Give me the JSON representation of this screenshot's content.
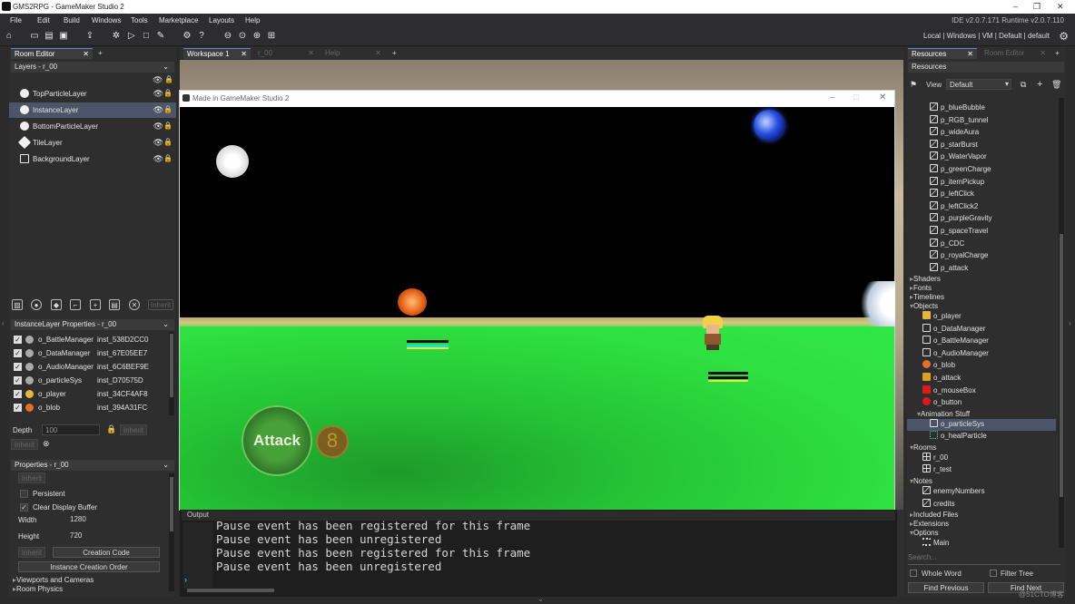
{
  "window": {
    "title": "GMS2RPG - GameMaker Studio 2",
    "ide_version": "IDE v2.0.7.171 Runtime v2.0.7.110"
  },
  "menu": [
    "File",
    "Edit",
    "Build",
    "Windows",
    "Tools",
    "Marketplace",
    "Layouts",
    "Help"
  ],
  "target_bar": "Local | Windows | VM | Default | default",
  "left": {
    "tab": "Room Editor",
    "layers_header": "Layers - r_00",
    "layers": [
      "TopParticleLayer",
      "InstanceLayer",
      "BottomParticleLayer",
      "TileLayer",
      "BackgroundLayer"
    ],
    "inherit_label": "Inherit",
    "instance_header": "InstanceLayer Properties - r_00",
    "instances": [
      {
        "name": "o_BattleManager",
        "id": "inst_538D2CC0"
      },
      {
        "name": "o_DataManager",
        "id": "inst_67E05EE7"
      },
      {
        "name": "o_AudioManager",
        "id": "inst_6C6BEF9E"
      },
      {
        "name": "o_particleSys",
        "id": "inst_D70575D"
      },
      {
        "name": "o_player",
        "id": "inst_34CF4AF8"
      },
      {
        "name": "o_blob",
        "id": "inst_394A31FC"
      }
    ],
    "depth_label": "Depth",
    "depth_value": "100",
    "properties_header": "Properties - r_00",
    "persistent_label": "Persistent",
    "clear_display_label": "Clear Display Buffer",
    "width_label": "Width",
    "width_value": "1280",
    "height_label": "Height",
    "height_value": "720",
    "creation_code": "Creation Code",
    "instance_creation_order": "Instance Creation Order",
    "viewports": "Viewports and Cameras",
    "room_physics": "Room Physics"
  },
  "center": {
    "tabs": [
      "Workspace 1",
      "r_00",
      "Help"
    ],
    "game_window_title": "Made in GameMaker Studio 2",
    "attack_label": "Attack",
    "output_title": "Output",
    "output_lines": [
      "Pause event has been registered for this frame",
      "Pause event has been unregistered",
      "Pause event has been registered for this frame",
      "Pause event has been unregistered"
    ]
  },
  "right": {
    "tabs": [
      "Resources",
      "Room Editor"
    ],
    "header": "Resources",
    "view_label": "View",
    "view_value": "Default",
    "particles": [
      "p_blueBubble",
      "p_RGB_tunnel",
      "p_wideAura",
      "p_starBurst",
      "p_WaterVapor",
      "p_greenCharge",
      "p_itemPickup",
      "p_leftClick",
      "p_leftClick2",
      "p_purpleGravity",
      "p_spaceTravel",
      "p_CDC",
      "p_royalCharge",
      "p_attack"
    ],
    "groups_a": [
      "Shaders",
      "Fonts",
      "Timelines"
    ],
    "objects_label": "Objects",
    "objects": [
      "o_player",
      "o_DataManager",
      "o_BattleManager",
      "o_AudioManager",
      "o_blob",
      "o_attack",
      "o_mouseBox",
      "o_button"
    ],
    "anim_group": "Animation Stuff",
    "anim_items": [
      "o_particleSys",
      "o_healParticle"
    ],
    "rooms_label": "Rooms",
    "rooms": [
      "r_00",
      "r_test"
    ],
    "notes_label": "Notes",
    "notes": [
      "enemyNumbers",
      "credits"
    ],
    "groups_b": [
      "Included Files",
      "Extensions"
    ],
    "options_label": "Options",
    "options": [
      "Main"
    ],
    "search_placeholder": "Search...",
    "whole_word": "Whole Word",
    "filter_tree": "Filter Tree",
    "find_previous": "Find Previous",
    "find_next": "Find Next",
    "watermark": "@51CTO博客"
  }
}
